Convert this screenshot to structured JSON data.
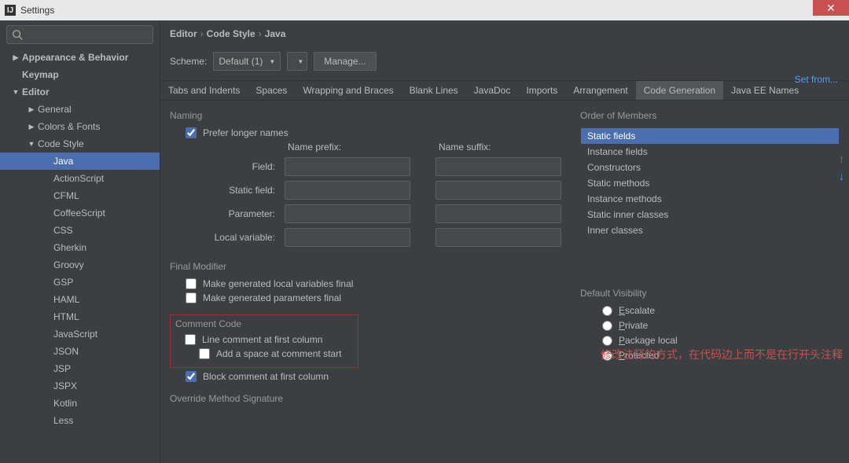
{
  "window": {
    "title": "Settings"
  },
  "tree": {
    "items": [
      {
        "label": "Appearance & Behavior",
        "bold": true,
        "arrow": "▶",
        "indent": 0
      },
      {
        "label": "Keymap",
        "bold": true,
        "arrow": "",
        "indent": 0
      },
      {
        "label": "Editor",
        "bold": true,
        "arrow": "▼",
        "indent": 0
      },
      {
        "label": "General",
        "bold": false,
        "arrow": "▶",
        "indent": 1
      },
      {
        "label": "Colors & Fonts",
        "bold": false,
        "arrow": "▶",
        "indent": 1
      },
      {
        "label": "Code Style",
        "bold": false,
        "arrow": "▼",
        "indent": 1
      },
      {
        "label": "Java",
        "bold": false,
        "arrow": "",
        "indent": 2,
        "selected": true
      },
      {
        "label": "ActionScript",
        "bold": false,
        "arrow": "",
        "indent": 2
      },
      {
        "label": "CFML",
        "bold": false,
        "arrow": "",
        "indent": 2
      },
      {
        "label": "CoffeeScript",
        "bold": false,
        "arrow": "",
        "indent": 2
      },
      {
        "label": "CSS",
        "bold": false,
        "arrow": "",
        "indent": 2
      },
      {
        "label": "Gherkin",
        "bold": false,
        "arrow": "",
        "indent": 2
      },
      {
        "label": "Groovy",
        "bold": false,
        "arrow": "",
        "indent": 2
      },
      {
        "label": "GSP",
        "bold": false,
        "arrow": "",
        "indent": 2
      },
      {
        "label": "HAML",
        "bold": false,
        "arrow": "",
        "indent": 2
      },
      {
        "label": "HTML",
        "bold": false,
        "arrow": "",
        "indent": 2
      },
      {
        "label": "JavaScript",
        "bold": false,
        "arrow": "",
        "indent": 2
      },
      {
        "label": "JSON",
        "bold": false,
        "arrow": "",
        "indent": 2
      },
      {
        "label": "JSP",
        "bold": false,
        "arrow": "",
        "indent": 2
      },
      {
        "label": "JSPX",
        "bold": false,
        "arrow": "",
        "indent": 2
      },
      {
        "label": "Kotlin",
        "bold": false,
        "arrow": "",
        "indent": 2
      },
      {
        "label": "Less",
        "bold": false,
        "arrow": "",
        "indent": 2
      }
    ]
  },
  "breadcrumb": {
    "a": "Editor",
    "b": "Code Style",
    "c": "Java"
  },
  "scheme": {
    "label": "Scheme:",
    "value": "Default (1)",
    "manage": "Manage...",
    "setfrom": "Set from..."
  },
  "tabs": [
    "Tabs and Indents",
    "Spaces",
    "Wrapping and Braces",
    "Blank Lines",
    "JavaDoc",
    "Imports",
    "Arrangement",
    "Code Generation",
    "Java EE Names"
  ],
  "active_tab": 7,
  "naming": {
    "title": "Naming",
    "prefer_longer": "Prefer longer names",
    "prefix_hdr": "Name prefix:",
    "suffix_hdr": "Name suffix:",
    "rows": [
      "Field:",
      "Static field:",
      "Parameter:",
      "Local variable:"
    ]
  },
  "final_mod": {
    "title": "Final Modifier",
    "opt1": "Make generated local variables final",
    "opt2": "Make generated parameters final"
  },
  "comment": {
    "title": "Comment Code",
    "opt1": "Line comment at first column",
    "opt2": "Add a space at comment start",
    "opt3": "Block comment at first column"
  },
  "override": {
    "title": "Override Method Signature"
  },
  "order": {
    "title": "Order of Members",
    "items": [
      "Static fields",
      "Instance fields",
      "Constructors",
      "Static methods",
      "Instance methods",
      "Static inner classes",
      "Inner classes"
    ]
  },
  "visibility": {
    "title": "Default Visibility",
    "opts": [
      "Escalate",
      "Private",
      "Package local",
      "Protected"
    ]
  },
  "annotation": "修改注释的方式，在代码边上而不是在行开头注释"
}
